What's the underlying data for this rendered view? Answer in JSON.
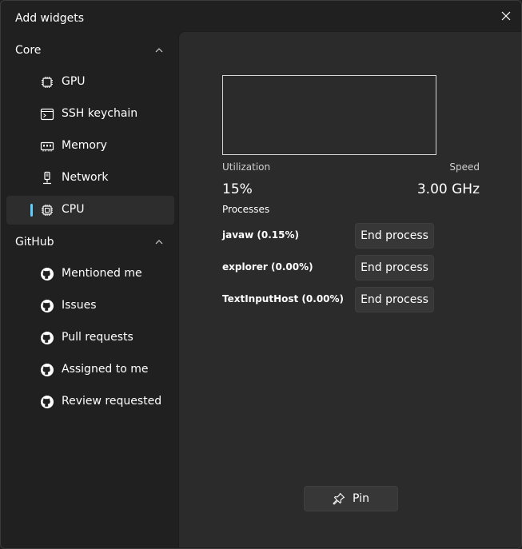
{
  "window": {
    "title": "Add widgets",
    "close_icon": "close-icon"
  },
  "sidebar": {
    "groups": [
      {
        "label": "Core",
        "expanded": true,
        "items": [
          {
            "label": "GPU",
            "icon": "chip-icon",
            "selected": false
          },
          {
            "label": "SSH keychain",
            "icon": "terminal-icon",
            "selected": false
          },
          {
            "label": "Memory",
            "icon": "memory-icon",
            "selected": false
          },
          {
            "label": "Network",
            "icon": "network-icon",
            "selected": false
          },
          {
            "label": "CPU",
            "icon": "cpu-icon",
            "selected": true
          }
        ]
      },
      {
        "label": "GitHub",
        "expanded": true,
        "items": [
          {
            "label": "Mentioned me",
            "icon": "github-icon",
            "selected": false
          },
          {
            "label": "Issues",
            "icon": "github-icon",
            "selected": false
          },
          {
            "label": "Pull requests",
            "icon": "github-icon",
            "selected": false
          },
          {
            "label": "Assigned to me",
            "icon": "github-icon",
            "selected": false
          },
          {
            "label": "Review requested",
            "icon": "github-icon",
            "selected": false
          }
        ]
      }
    ]
  },
  "widget": {
    "utilization_label": "Utilization",
    "utilization_value": "15%",
    "speed_label": "Speed",
    "speed_value": "3.00 GHz",
    "processes_label": "Processes",
    "processes": [
      {
        "name": "javaw (0.15%)",
        "action": "End process"
      },
      {
        "name": "explorer (0.00%)",
        "action": "End process"
      },
      {
        "name": "TextInputHost (0.00%)",
        "action": "End process"
      }
    ]
  },
  "footer": {
    "pin_label": "Pin",
    "pin_icon": "pin-icon"
  },
  "colors": {
    "accent": "#60cdff",
    "background": "#202020",
    "panel": "#2b2b2b",
    "selected": "#2d2d2d"
  }
}
